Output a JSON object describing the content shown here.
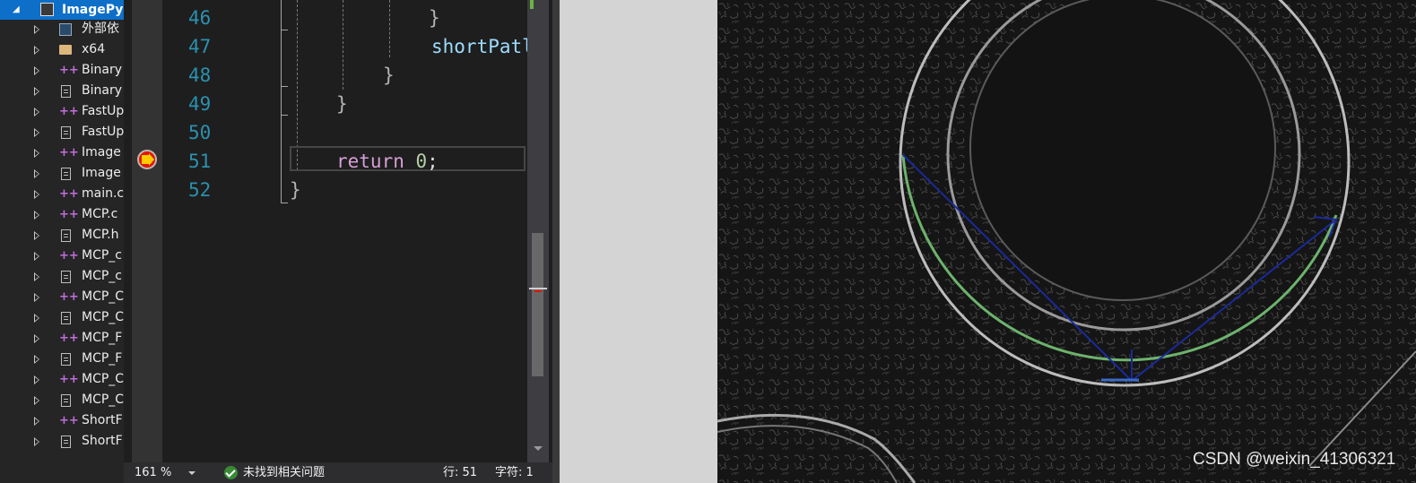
{
  "explorer": {
    "project": "ImagePy",
    "items": [
      {
        "label": "外部依",
        "icon": "external-deps-icon"
      },
      {
        "label": "x64",
        "icon": "folder-icon"
      },
      {
        "label": "Binary",
        "icon": "cpp-file-icon"
      },
      {
        "label": "Binary",
        "icon": "header-file-icon"
      },
      {
        "label": "FastUp",
        "icon": "cpp-file-icon"
      },
      {
        "label": "FastUp",
        "icon": "header-file-icon"
      },
      {
        "label": "Image",
        "icon": "cpp-file-icon"
      },
      {
        "label": "Image",
        "icon": "header-file-icon"
      },
      {
        "label": "main.c",
        "icon": "cpp-file-icon"
      },
      {
        "label": "MCP.c",
        "icon": "cpp-file-icon"
      },
      {
        "label": "MCP.h",
        "icon": "header-file-icon"
      },
      {
        "label": "MCP_c",
        "icon": "cpp-file-icon"
      },
      {
        "label": "MCP_c",
        "icon": "header-file-icon"
      },
      {
        "label": "MCP_C",
        "icon": "cpp-file-icon"
      },
      {
        "label": "MCP_C",
        "icon": "header-file-icon"
      },
      {
        "label": "MCP_F",
        "icon": "cpp-file-icon"
      },
      {
        "label": "MCP_F",
        "icon": "header-file-icon"
      },
      {
        "label": "MCP_C",
        "icon": "cpp-file-icon"
      },
      {
        "label": "MCP_C",
        "icon": "header-file-icon"
      },
      {
        "label": "ShortF",
        "icon": "cpp-file-icon"
      },
      {
        "label": "ShortF",
        "icon": "header-file-icon"
      }
    ]
  },
  "editor": {
    "lines": [
      {
        "num": "46",
        "code": "}"
      },
      {
        "num": "47",
        "code": "shortPatl"
      },
      {
        "num": "48",
        "code": "}"
      },
      {
        "num": "49",
        "code": "}"
      },
      {
        "num": "50",
        "code": ""
      },
      {
        "num": "51",
        "keyword": "return",
        "number": "0",
        "tail": ";"
      },
      {
        "num": "52",
        "code": "}"
      }
    ],
    "breakpoint_line": "51"
  },
  "status": {
    "zoom": "161 %",
    "issues": "未找到相关问题",
    "row": "行: 51",
    "col": "字符: 1"
  },
  "image": {
    "watermark": "CSDN @weixin_41306321",
    "colors": {
      "fit_circle": "#6db36d",
      "lines": "#1a2a9a",
      "edges": "#c8c8c8"
    }
  }
}
